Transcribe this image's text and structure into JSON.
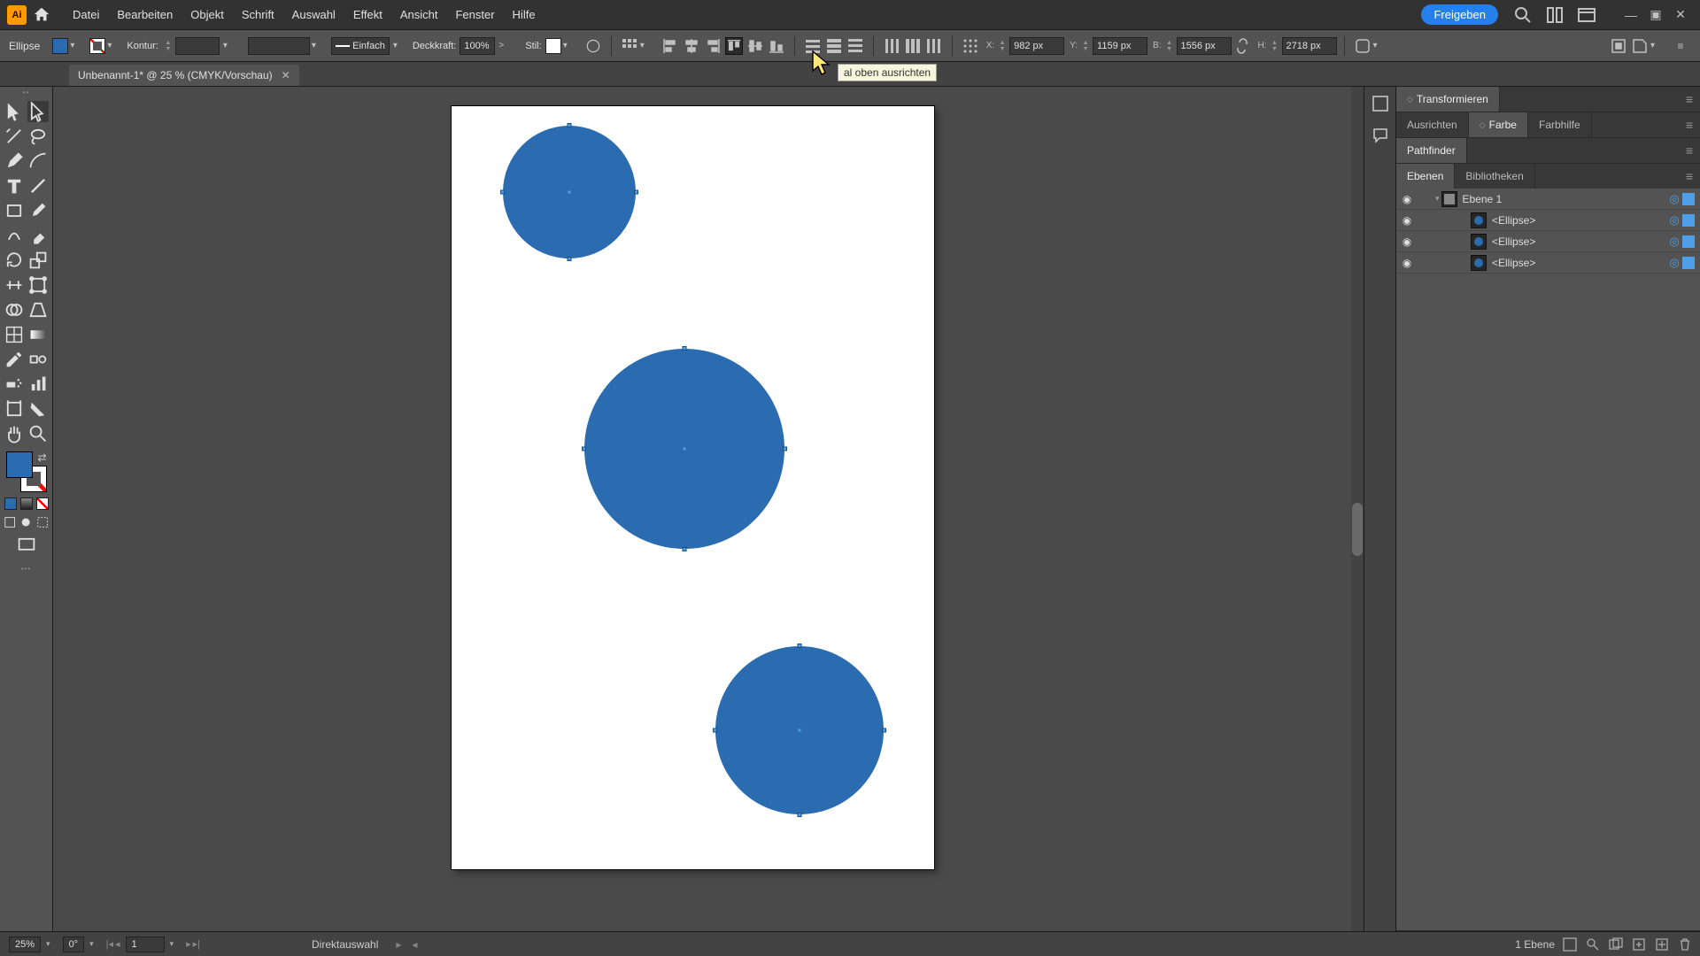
{
  "app_icon_text": "Ai",
  "menu": {
    "datei": "Datei",
    "bearbeiten": "Bearbeiten",
    "objekt": "Objekt",
    "schrift": "Schrift",
    "auswahl": "Auswahl",
    "effekt": "Effekt",
    "ansicht": "Ansicht",
    "fenster": "Fenster",
    "hilfe": "Hilfe"
  },
  "share_label": "Freigeben",
  "control": {
    "selection": "Ellipse",
    "kontur_label": "Kontur:",
    "kontur_value": "",
    "profile_label": "Einfach",
    "opacity_label": "Deckkraft:",
    "opacity_value": "100%",
    "style_label": "Stil:",
    "x_label": "X:",
    "x_value": "982 px",
    "y_label": "Y:",
    "y_value": "1159 px",
    "b_label": "B:",
    "b_value": "1556 px",
    "h_label": "H:",
    "h_value": "2718 px"
  },
  "tooltip_text": "al oben ausrichten",
  "doc_tab": {
    "title": "Unbenannt-1* @ 25 % (CMYK/Vorschau)"
  },
  "panels": {
    "transform": "Transformieren",
    "ausrichten": "Ausrichten",
    "farbe": "Farbe",
    "farbhilfe": "Farbhilfe",
    "pathfinder": "Pathfinder",
    "ebenen": "Ebenen",
    "bibliotheken": "Bibliotheken"
  },
  "layers": {
    "layer1_name": "Ebene 1",
    "ellipse_label": "<Ellipse>"
  },
  "status": {
    "zoom": "25%",
    "rotate": "0°",
    "artboard_no": "1",
    "mode": "Direktauswahl",
    "layer_count": "1 Ebene"
  },
  "colors": {
    "shape_fill": "#2b6cb0"
  }
}
